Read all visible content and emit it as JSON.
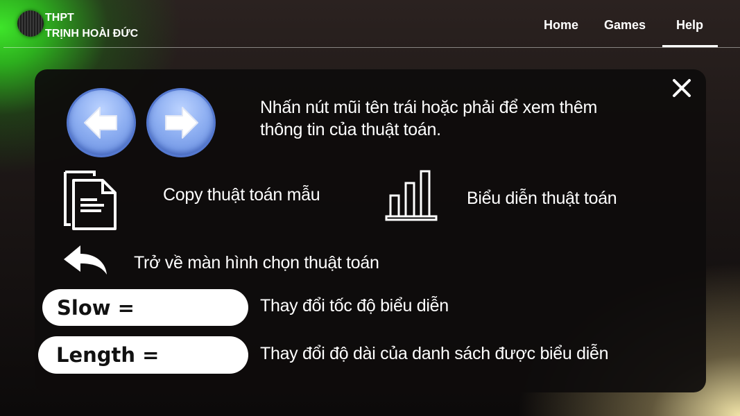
{
  "header": {
    "school_line1": "THPT",
    "school_line2": "TRỊNH HOÀI ĐỨC",
    "nav": {
      "home": "Home",
      "games": "Games",
      "help": "Help"
    },
    "active_tab": "Help"
  },
  "help": {
    "arrows_desc": [
      "Nhấn nút mũi tên trái hoặc phải để xem thêm",
      "thông tin của thuật toán."
    ],
    "copy_desc": "Copy thuật toán mẫu",
    "visualize_desc": "Biểu diễn thuật toán",
    "back_desc": "Trở về màn hình chọn thuật toán",
    "slow_label": "Slow =",
    "slow_desc": "Thay đổi tốc độ biểu diễn",
    "length_label": "Length =",
    "length_desc": "Thay đổi độ dài của danh sách được biểu diễn"
  },
  "icons": [
    "logo-icon",
    "close-icon",
    "arrow-left-icon",
    "arrow-right-icon",
    "copy-document-icon",
    "bar-chart-icon",
    "back-arrow-icon"
  ],
  "colors": {
    "accent_green": "#3ee52a",
    "arrow_blue": "#8fb0f2",
    "panel_bg": "#0e0c0c"
  }
}
